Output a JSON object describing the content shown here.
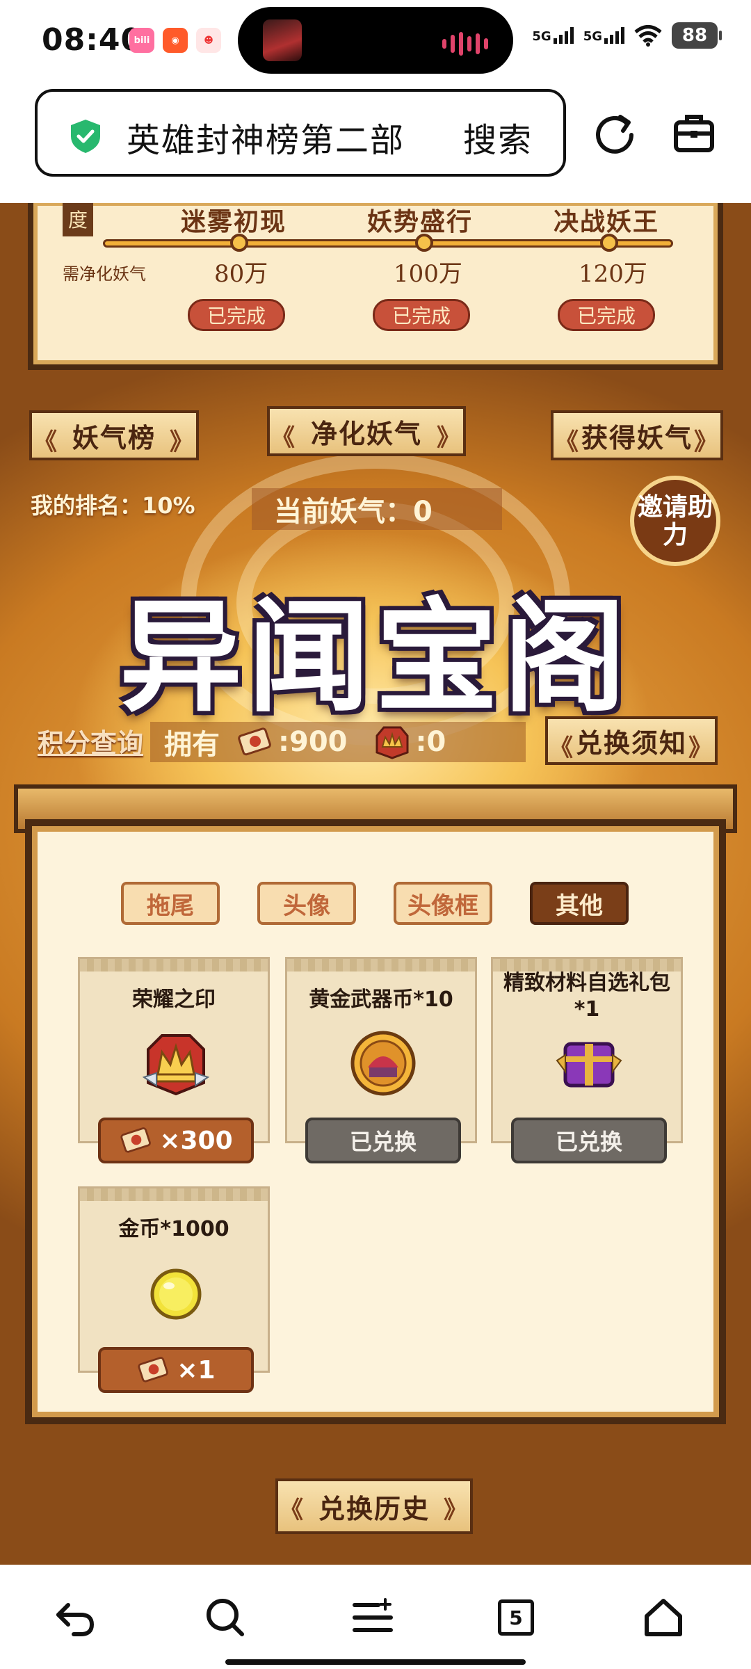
{
  "status_bar": {
    "time": "08:40",
    "app_icons": [
      "bilibili-icon",
      "pumpkin-app-icon",
      "mascot-app-icon"
    ],
    "signal_1": "5G",
    "signal_2": "5G",
    "battery": "88"
  },
  "browser": {
    "search_text": "英雄封神榜第二部",
    "search_button": "搜索"
  },
  "progress_panel": {
    "corner_tag": "度",
    "need_label": "需净化妖气",
    "stages": [
      {
        "name": "迷雾初现",
        "value": "80万",
        "status": "已完成"
      },
      {
        "name": "妖势盛行",
        "value": "100万",
        "status": "已完成"
      },
      {
        "name": "决战妖王",
        "value": "120万",
        "status": "已完成"
      }
    ]
  },
  "actions": {
    "leaderboard": "妖气榜",
    "purify": "净化妖气",
    "obtain": "获得妖气",
    "my_rank": "我的排名：10%",
    "current_qi": "当前妖气：0",
    "invite": "邀请助力"
  },
  "title": "异闻宝阁",
  "points": {
    "query": "积分查询",
    "own_label": "拥有",
    "token_amount": ":900",
    "crown_amount": ":0",
    "exchange_notice": "兑换须知"
  },
  "shop": {
    "tabs": [
      {
        "label": "拖尾",
        "active": false
      },
      {
        "label": "头像",
        "active": false
      },
      {
        "label": "头像框",
        "active": false
      },
      {
        "label": "其他",
        "active": true
      }
    ],
    "items": [
      {
        "name": "荣耀之印",
        "icon": "crown-seal-icon",
        "price": "×300",
        "redeemed": false
      },
      {
        "name": "黄金武器币*10",
        "icon": "gold-weapon-coin-icon",
        "status": "已兑换",
        "redeemed": true
      },
      {
        "name": "精致材料自选礼包*1",
        "icon": "purple-gift-chest-icon",
        "status": "已兑换",
        "redeemed": true
      },
      {
        "name": "金币*1000",
        "icon": "gold-coin-icon",
        "price": "×1",
        "redeemed": false
      }
    ]
  },
  "history": "兑换历史",
  "bottom_nav": {
    "tabs_count": "5"
  },
  "colors": {
    "panel_border": "#4a2a12",
    "active_tab": "#7a3e18",
    "price_button": "#b4602c",
    "redeemed_button": "#6f6a64"
  }
}
